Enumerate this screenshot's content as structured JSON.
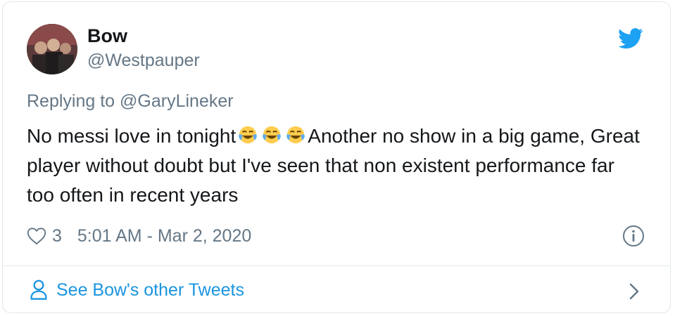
{
  "tweet": {
    "author_name": "Bow",
    "author_handle": "@Westpauper",
    "replying_prefix": "Replying to",
    "replying_mention": "@GaryLineker",
    "text_before_emoji": "No messi love in tonight",
    "emoji_name": "face-with-tears-of-joy-icon",
    "text_after_emoji": "Another no show in a big game, Great player without doubt but I've seen that non existent performance far too often in recent years",
    "like_count": "3",
    "timestamp": "5:01 AM - Mar 2, 2020"
  },
  "footer": {
    "see_more_label": "See Bow's other Tweets"
  },
  "icons": {
    "brand": "twitter-bird-icon",
    "like": "heart-icon",
    "info": "info-icon",
    "person": "person-icon",
    "chevron": "chevron-right-icon"
  },
  "colors": {
    "brand_blue": "#1da1f2",
    "link_blue": "#1b95e0",
    "secondary_text": "#657786",
    "primary_text": "#14171a",
    "border": "#e1e8ed"
  }
}
